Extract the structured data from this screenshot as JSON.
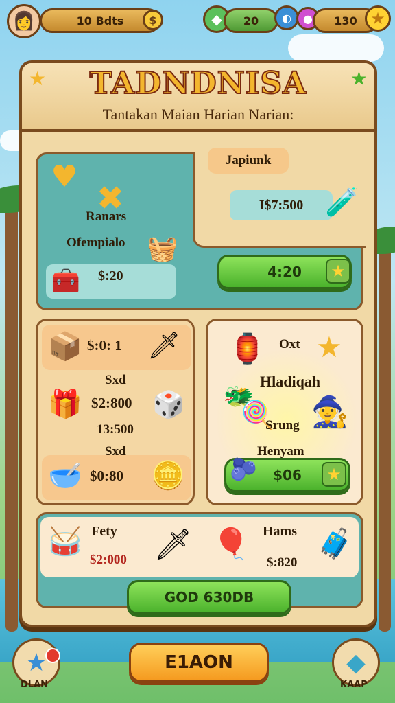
{
  "status_bar": {
    "currency_label": "10 Bdts",
    "gems_count": "20",
    "stars_count": "130"
  },
  "panel": {
    "title": "TADNDNISA",
    "subtitle": "Tantakan Maian Harian Narian:"
  },
  "daily_offer": {
    "item1_name": "Ranars",
    "item2_name": "Ofempialo",
    "item3_price": "$:20",
    "tag_label": "Japiunk",
    "tag_price": "I$7:500",
    "buy_label": "4:20"
  },
  "shop_items": {
    "row1_price": "$:0: 1",
    "row2_name": "Sxd",
    "row2_price": "$2:800",
    "row3_price": "13:500",
    "row4_name": "Sxd",
    "row4_price": "$0:80"
  },
  "reward": {
    "label_top": "Oxt",
    "title": "Hladiqah",
    "name": "Srung",
    "caption": "Henyam",
    "buy_label": "$06"
  },
  "bottom_strip": {
    "item1_name": "Fety",
    "item1_price": "$2:000",
    "item2_name": "Hams",
    "item2_price": "$:820",
    "main_button": "GOD 630DB"
  },
  "footer": {
    "left_label": "DLAN",
    "center_button": "E1AON",
    "right_label": "KAAP"
  },
  "colors": {
    "accent_green": "#4bb22c",
    "panel_wood": "#7a4b1e",
    "teal": "#5fb3ad",
    "title_gold": "#f3b62e"
  },
  "icons": {
    "currency": "coin-icon",
    "gem": "green-gem-icon",
    "orb": "purple-orb-icon",
    "star": "star-icon"
  }
}
